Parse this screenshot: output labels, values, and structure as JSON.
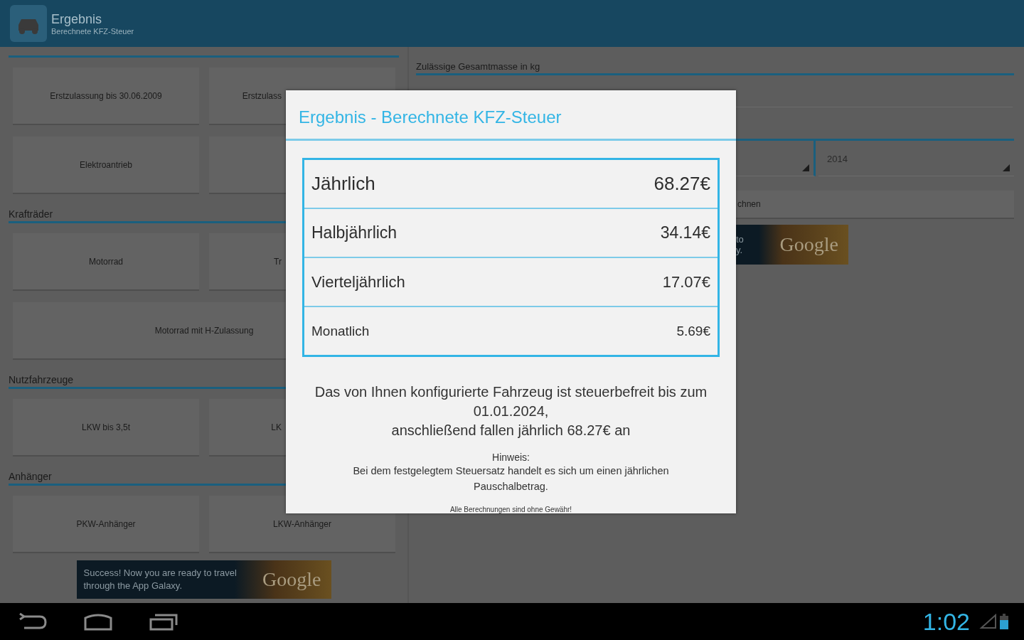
{
  "action_bar": {
    "title": "Ergebnis",
    "subtitle": "Berechnete KFZ-Steuer"
  },
  "left_sections": [
    {
      "buttons": [
        {
          "kind": "half",
          "label": "Erstzulassung bis 30.06.2009"
        },
        {
          "kind": "covered",
          "label": "Erstzulass"
        },
        {
          "kind": "half",
          "label": "Elektroantrieb"
        },
        {
          "kind": "half"
        }
      ]
    },
    {
      "heading": "Krafträder",
      "buttons": [
        {
          "kind": "half",
          "label": "Motorrad"
        },
        {
          "kind": "covered",
          "label": "Tr"
        },
        {
          "kind": "wide",
          "label": "Motorrad mit H-Zulassung"
        }
      ]
    },
    {
      "heading": "Nutzfahrzeuge",
      "buttons": [
        {
          "kind": "half",
          "label": "LKW bis 3,5t"
        },
        {
          "kind": "covered",
          "label": "LK"
        }
      ]
    },
    {
      "heading": "Anhänger",
      "buttons": [
        {
          "kind": "half",
          "label": "PKW-Anhänger"
        },
        {
          "kind": "half",
          "label": "LKW-Anhänger"
        }
      ]
    }
  ],
  "left_ad": {
    "text": "Success! Now you are ready to travel through the App Galaxy.",
    "brand": "Google"
  },
  "right_panel": {
    "mass_label": "Zulässige Gesamtmasse in kg",
    "year_spinner": "2014",
    "button": "chnen",
    "ad": {
      "text_1": "to",
      "text_2": "y.",
      "brand": "Google"
    }
  },
  "dialog": {
    "title": "Ergebnis - Berechnete KFZ-Steuer",
    "rows": [
      {
        "label": "Jährlich",
        "value": "68.27€"
      },
      {
        "label": "Halbjährlich",
        "value": "34.14€"
      },
      {
        "label": "Vierteljährlich",
        "value": "17.07€"
      },
      {
        "label": "Monatlich",
        "value": "5.69€"
      }
    ],
    "message": [
      "Das von Ihnen konfigurierte Fahrzeug ist steuerbefreit bis zum",
      "01.01.2024,",
      "anschließend fallen jährlich 68.27€ an"
    ],
    "hint_title": "Hinweis:",
    "hint": "Bei dem festgelegtem Steuersatz handelt es sich um einen jährlichen Pauschalbetrag.",
    "disclaimer": "Alle Berechnungen sind ohne Gewähr!"
  },
  "status": {
    "time": "1:02"
  }
}
